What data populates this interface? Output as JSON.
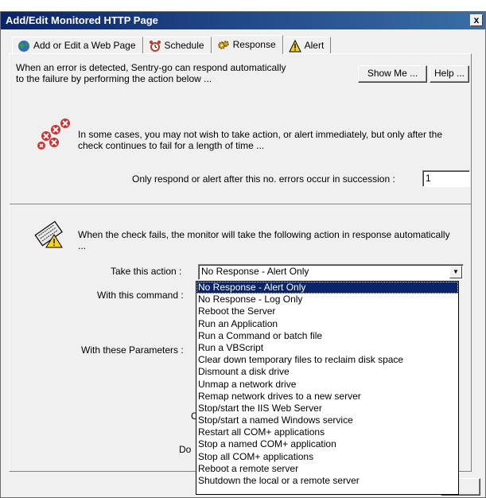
{
  "window": {
    "title": "Add/Edit Monitored HTTP Page",
    "close_label": "x"
  },
  "tabs": [
    {
      "label": "Add or Edit a Web Page",
      "icon": "globe-icon"
    },
    {
      "label": "Schedule",
      "icon": "alarm-clock-icon"
    },
    {
      "label": "Response",
      "icon": "gears-icon"
    },
    {
      "label": "Alert",
      "icon": "warning-icon"
    }
  ],
  "response": {
    "intro": "When an error is detected, Sentry-go can respond automatically to the failure by performing the action below ...",
    "show_me_label": "Show Me ...",
    "help_label": "Help ...",
    "errors_text": "In some cases, you may not wish to take action, or alert immediately, but only after the check continues to fail for a length of time ...",
    "succession_label": "Only respond or alert after this no. errors occur in succession :",
    "succession_value": "1",
    "action_text": "When the check fails, the monitor will take the following action in response automatically ...",
    "take_action_label": "Take this action :",
    "take_action_value": "No Response - Alert Only",
    "command_label": "With this command :",
    "parameters_label": "With these Parameters :",
    "partial_c": "C",
    "partial_do": "Do"
  },
  "dropdown": {
    "selected_index": 0,
    "options": [
      "No Response - Alert Only",
      "No Response - Log Only",
      "Reboot the Server",
      "Run an Application",
      "Run a Command or batch file",
      "Run a VBScript",
      "Clear down temporary files to reclaim disk space",
      "Dismount a disk drive",
      "Unmap a network drive",
      "Remap network drives to a new server",
      "Stop/start the IIS Web Server",
      "Stop/start a named Windows service",
      "Restart all COM+ applications",
      "Stop a named COM+ application",
      "Stop all COM+ applications",
      "Reboot a remote server",
      "Shutdown the local or a remote server"
    ]
  },
  "colors": {
    "titlebar_start": "#0a246a",
    "titlebar_end": "#3a6ea5",
    "selection": "#0a246a",
    "dialog_bg": "#f0f0f0"
  }
}
